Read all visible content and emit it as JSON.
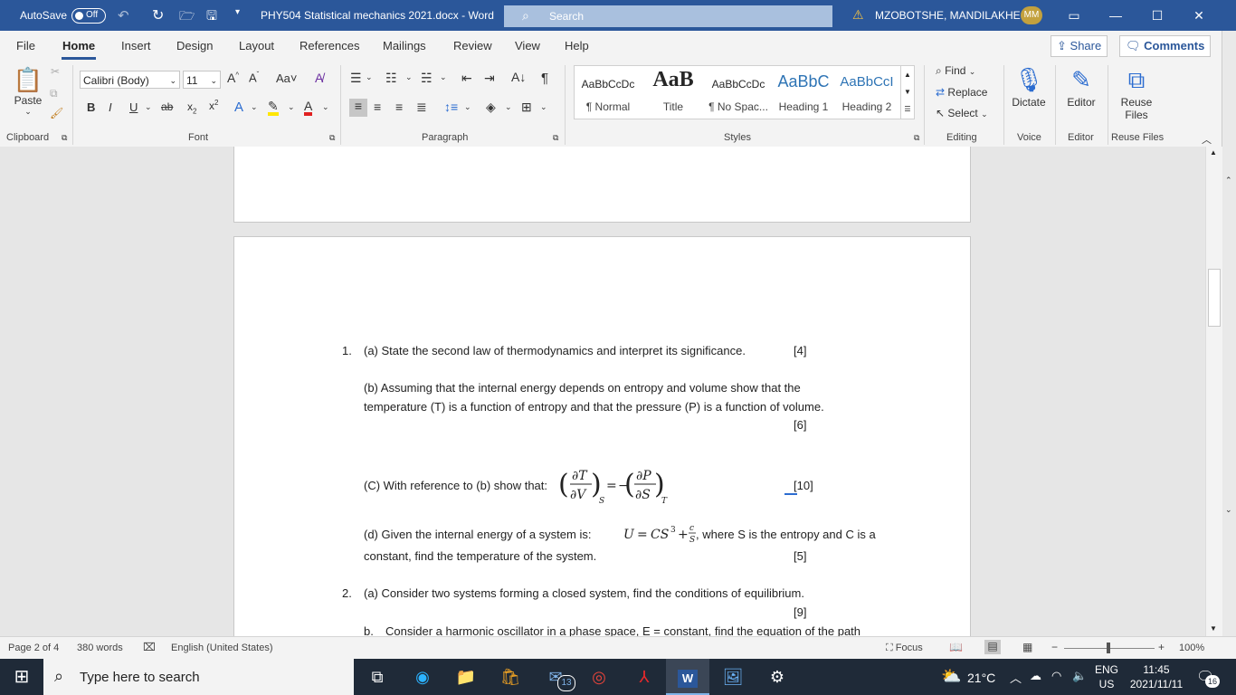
{
  "titlebar": {
    "autosave_label": "AutoSave",
    "autosave_state": "Off",
    "doc_title": "PHY504 Statistical mechanics 2021.docx  -  Word",
    "search_placeholder": "Search",
    "user_name": "MZOBOTSHE, MANDILAKHE",
    "user_initials": "MM"
  },
  "tabs": [
    "File",
    "Home",
    "Insert",
    "Design",
    "Layout",
    "References",
    "Mailings",
    "Review",
    "View",
    "Help"
  ],
  "active_tab": "Home",
  "share_label": "Share",
  "comments_label": "Comments",
  "ribbon": {
    "clipboard": {
      "paste": "Paste",
      "label": "Clipboard"
    },
    "font": {
      "name": "Calibri (Body)",
      "size": "11",
      "label": "Font",
      "case": "Aa"
    },
    "paragraph": {
      "label": "Paragraph"
    },
    "styles": {
      "label": "Styles",
      "items": [
        {
          "preview": "AaBbCcDc",
          "name": "¶ Normal"
        },
        {
          "preview": "AaB",
          "name": "Title"
        },
        {
          "preview": "AaBbCcDc",
          "name": "¶ No Spac..."
        },
        {
          "preview": "AaBbC",
          "name": "Heading 1"
        },
        {
          "preview": "AaBbCcI",
          "name": "Heading 2"
        }
      ]
    },
    "editing": {
      "find": "Find",
      "replace": "Replace",
      "select": "Select",
      "label": "Editing"
    },
    "voice": {
      "dictate": "Dictate",
      "label": "Voice"
    },
    "editor": {
      "editor": "Editor",
      "label": "Editor"
    },
    "reuse": {
      "line1": "Reuse",
      "line2": "Files",
      "label": "Reuse Files"
    }
  },
  "document": {
    "q1_num": "1.",
    "q1a": "(a) State the second law of thermodynamics and interpret its significance.",
    "q1a_marks": "[4]",
    "q1b_line1": "(b) Assuming that the internal energy depends on entropy and volume show that the",
    "q1b_line2": "temperature (T) is a function of entropy and that the pressure (P) is a function of volume.",
    "q1b_marks": "[6]",
    "q1c_text": "(C) With reference to (b) show that:",
    "q1c_marks": "[10]",
    "q1d_line1_a": "(d)  Given the internal energy of a system is:",
    "q1d_line1_b": ", where S is the entropy and C is a",
    "q1d_line2": "constant, find the temperature of the system.",
    "q1d_marks": "[5]",
    "q2_num": "2.",
    "q2a": "(a) Consider two systems forming a closed system, find the conditions of equilibrium.",
    "q2a_marks": "[9]",
    "q2b_num": "b.",
    "q2b": "Consider a harmonic oscillator in a phase space, E = constant, find the equation of the path"
  },
  "statusbar": {
    "page": "Page 2 of 4",
    "words": "380 words",
    "language": "English (United States)",
    "focus": "Focus",
    "zoom": "100%"
  },
  "taskbar": {
    "search_placeholder": "Type here to search",
    "mail_badge": "13",
    "temperature": "21°C",
    "lang1": "ENG",
    "lang2": "US",
    "time": "11:45",
    "date": "2021/11/11",
    "notif_count": "16"
  }
}
